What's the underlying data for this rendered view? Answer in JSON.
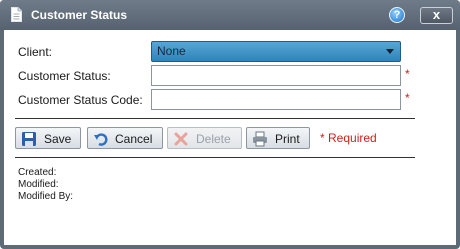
{
  "window": {
    "title": "Customer Status",
    "help_label": "?",
    "close_label": "x"
  },
  "form": {
    "client": {
      "label": "Client:",
      "value": "None"
    },
    "status": {
      "label": "Customer Status:",
      "value": ""
    },
    "status_code": {
      "label": "Customer Status Code:",
      "value": ""
    },
    "required_marker": "*"
  },
  "toolbar": {
    "save_label": "Save",
    "cancel_label": "Cancel",
    "delete_label": "Delete",
    "print_label": "Print",
    "required_note": "* Required"
  },
  "meta": {
    "created_label": "Created:",
    "modified_label": "Modified:",
    "modified_by_label": "Modified By:"
  },
  "colors": {
    "titlebar": "#5e6a76",
    "select_accent": "#3b90c4",
    "required": "#d02020"
  }
}
